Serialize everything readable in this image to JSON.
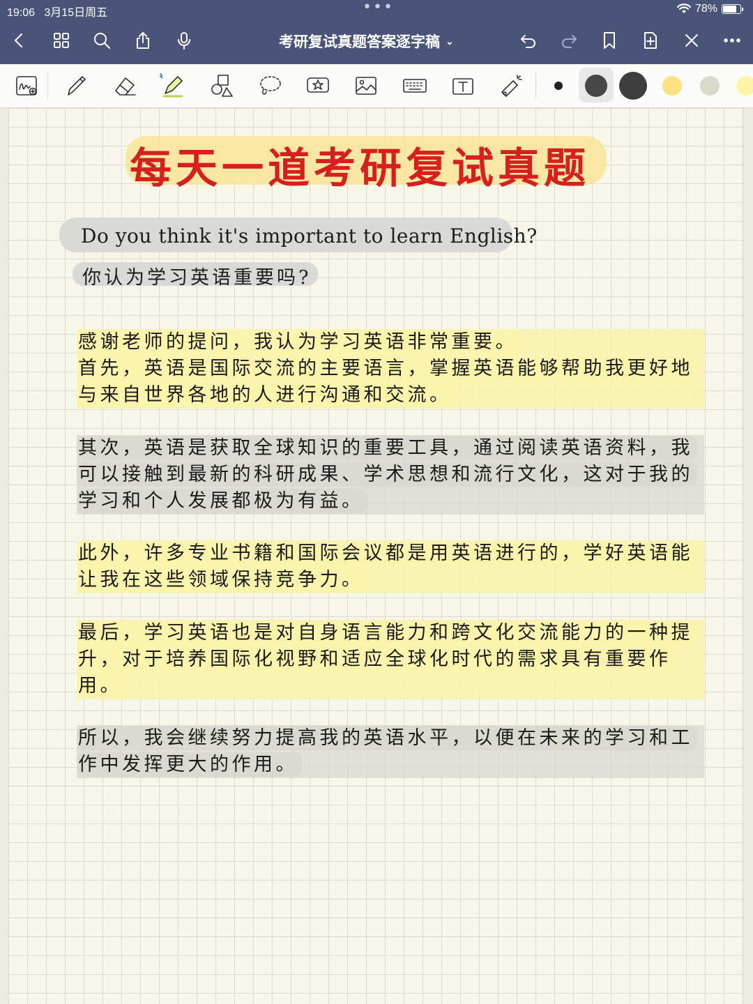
{
  "status": {
    "time": "19:06",
    "date": "3月15日周五",
    "battery": "78%",
    "battery_level": 0.78
  },
  "nav": {
    "title": "考研复试真题答案逐字稿",
    "icons": [
      "back-icon",
      "grid-icon",
      "search-icon",
      "share-icon",
      "microphone-icon",
      "undo-icon",
      "redo-icon",
      "bookmark-icon",
      "add-page-icon",
      "close-icon",
      "more-icon"
    ]
  },
  "toolbar": {
    "tools": [
      "handwriting-recognition-icon",
      "pen-icon",
      "eraser-icon",
      "highlighter-icon",
      "shapes-icon",
      "lasso-icon",
      "sticker-icon",
      "image-icon",
      "keyboard-icon",
      "text-icon",
      "laser-pointer-icon"
    ],
    "sizes": [
      "small",
      "medium",
      "large"
    ],
    "colors": [
      "#4a4a4a",
      "#ffe27a",
      "#d8d8c8",
      "#fff3a8"
    ]
  },
  "note": {
    "title": "每天一道考研复试真题",
    "question_en": "Do you think it's important to learn English?",
    "question_zh": "你认为学习英语重要吗?",
    "paragraphs": [
      [
        "感谢老师的提问，我认为学习英语非常重要。",
        "首先，英语是国际交流的主要语言，掌握英语能够帮助我更好地",
        "与来自世界各地的人进行沟通和交流。"
      ],
      [
        "其次，英语是获取全球知识的重要工具，通过阅读英语资料，我",
        "可以接触到最新的科研成果、学术思想和流行文化，这对于我的",
        "学习和个人发展都极为有益。"
      ],
      [
        "此外，许多专业书籍和国际会议都是用英语进行的，学好英语能",
        "让我在这些领域保持竞争力。"
      ],
      [
        "最后，学习英语也是对自身语言能力和跨文化交流能力的一种提",
        "升，对于培养国际化视野和适应全球化时代的需求具有重要作",
        "用。"
      ],
      [
        "所以，我会继续努力提高我的英语水平，以便在未来的学习和工",
        "作中发挥更大的作用。"
      ]
    ]
  }
}
